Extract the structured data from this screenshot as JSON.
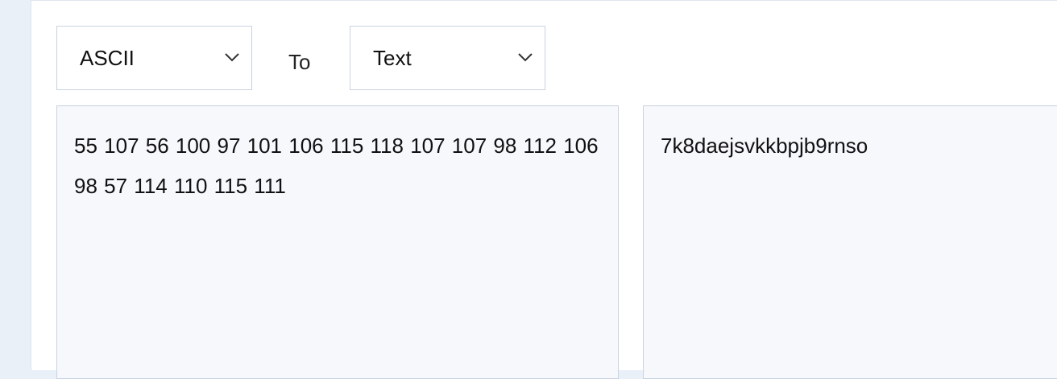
{
  "converter": {
    "from_select": {
      "value": "ASCII"
    },
    "to_label": "To",
    "to_select": {
      "value": "Text"
    },
    "input": {
      "text": "55 107 56 100 97 101 106 115 118 107 107 98 112 106 98 57 114 110 115 111"
    },
    "output": {
      "text": "7k8daejsvkkbpjb9rnso"
    }
  },
  "colors": {
    "page_background": "#eaf0f8",
    "panel_background": "#ffffff",
    "field_border": "#c9d3e2",
    "textarea_background": "#f6f8fc"
  },
  "icons": {
    "dropdown": "chevron-down-icon"
  }
}
